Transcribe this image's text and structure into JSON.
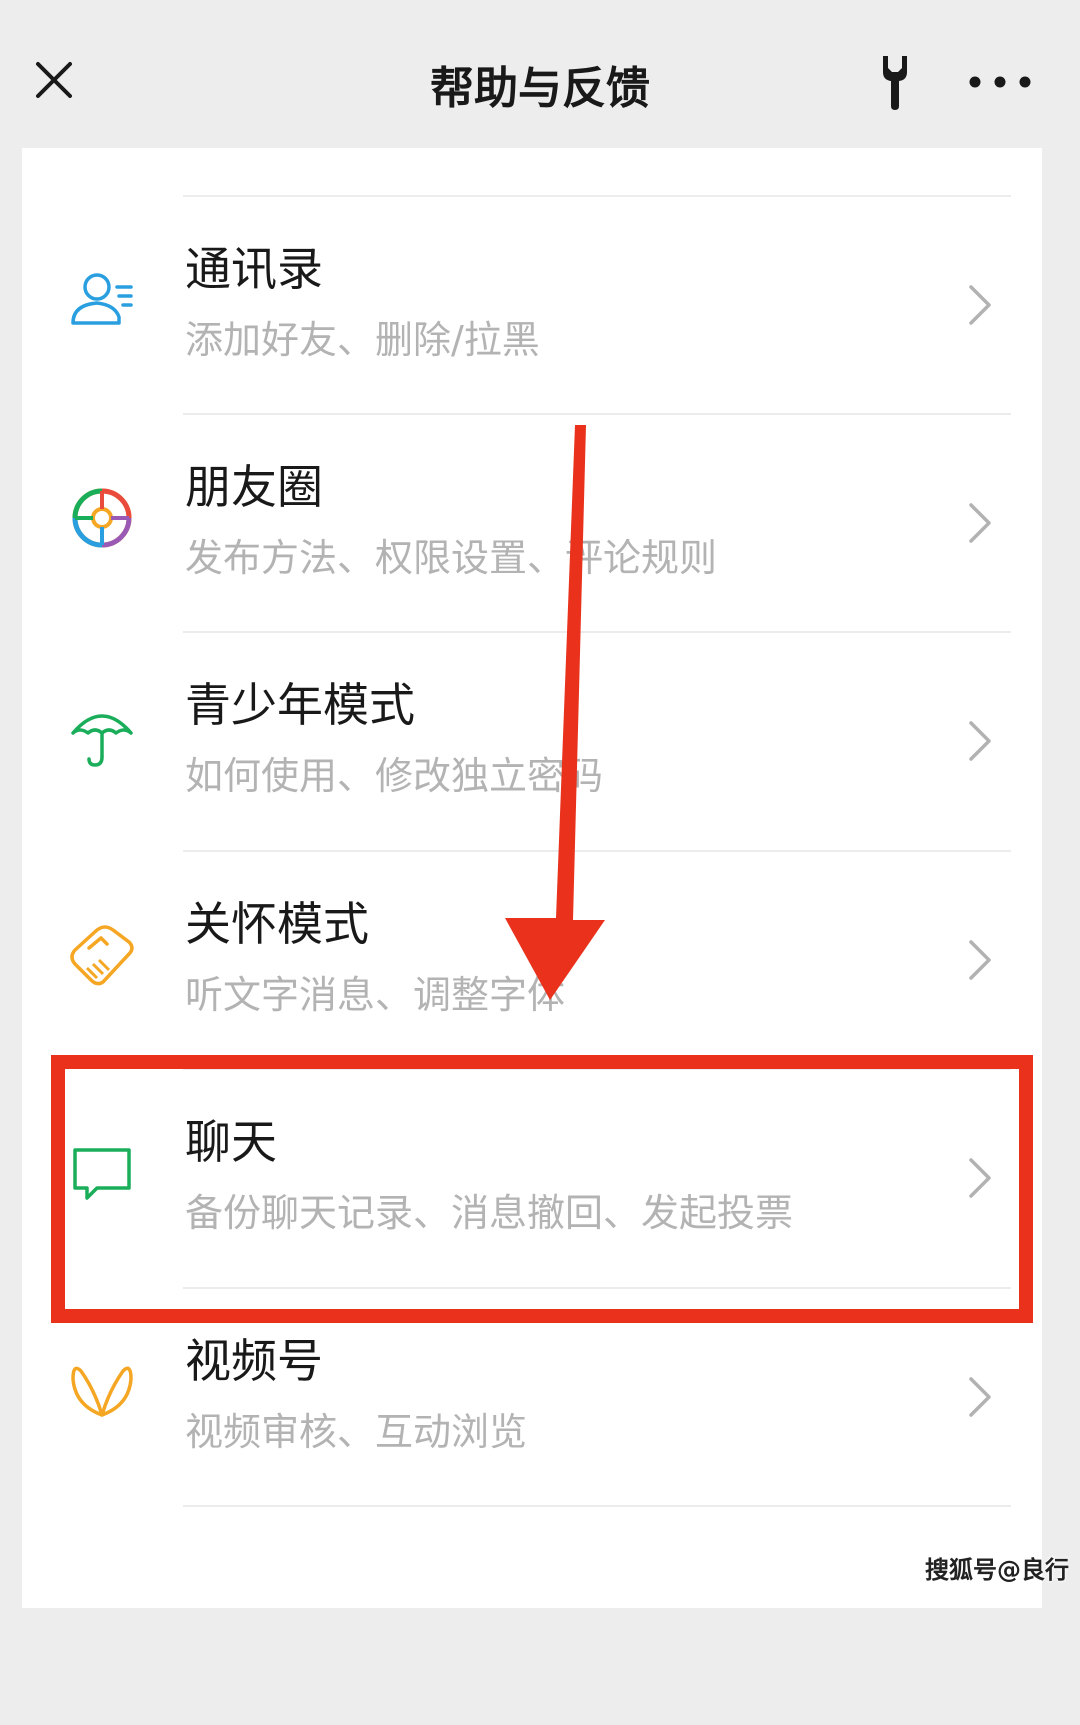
{
  "header": {
    "title": "帮助与反馈",
    "close_icon": "close-icon",
    "tools_icon": "wrench-icon",
    "more_icon": "more-icon"
  },
  "items": [
    {
      "title": "通讯录",
      "subtitle": "添加好友、删除/拉黑",
      "icon": "contacts-icon",
      "color": "#2a9fe0"
    },
    {
      "title": "朋友圈",
      "subtitle": "发布方法、权限设置、评论规则",
      "icon": "moments-icon",
      "color": "multicolor"
    },
    {
      "title": "青少年模式",
      "subtitle": "如何使用、修改独立密码",
      "icon": "umbrella-icon",
      "color": "#1aad5a"
    },
    {
      "title": "关怀模式",
      "subtitle": "听文字消息、调整字体",
      "icon": "care-icon",
      "color": "#f5a623"
    },
    {
      "title": "聊天",
      "subtitle": "备份聊天记录、消息撤回、发起投票",
      "icon": "chat-icon",
      "color": "#1aad5a",
      "highlighted": true
    },
    {
      "title": "视频号",
      "subtitle": "视频审核、互动浏览",
      "icon": "channels-icon",
      "color": "#f5a623"
    }
  ],
  "annotation": {
    "color": "#e9311c"
  },
  "watermark": "搜狐号@良行"
}
